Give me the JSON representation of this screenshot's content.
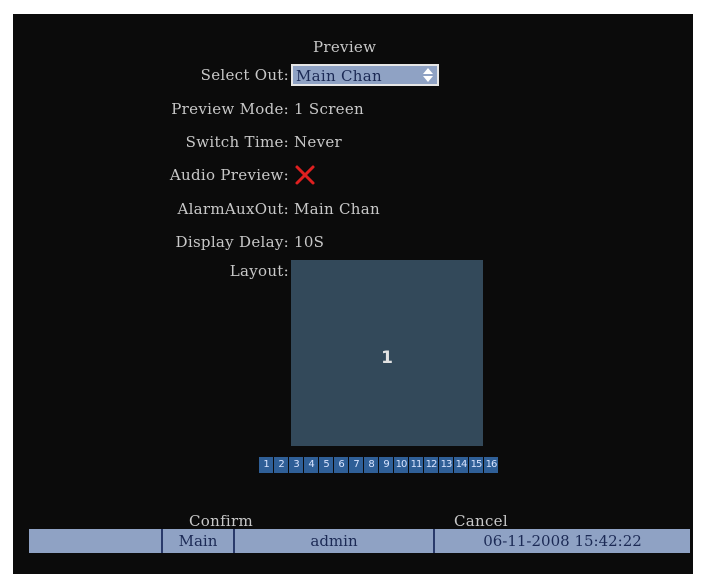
{
  "title": "Preview",
  "fields": {
    "select_out_label": "Select Out:",
    "select_out_value": "Main Chan",
    "preview_mode_label": "Preview Mode:",
    "preview_mode_value": "1 Screen",
    "switch_time_label": "Switch Time:",
    "switch_time_value": "Never",
    "audio_preview_label": "Audio Preview:",
    "audio_preview_enabled": false,
    "alarm_aux_out_label": "AlarmAuxOut:",
    "alarm_aux_out_value": "Main Chan",
    "display_delay_label": "Display Delay:",
    "display_delay_value": "10S",
    "layout_label": "Layout:"
  },
  "layout": {
    "window_number": "1",
    "channels": [
      "1",
      "2",
      "3",
      "4",
      "5",
      "6",
      "7",
      "8",
      "9",
      "10",
      "11",
      "12",
      "13",
      "14",
      "15",
      "16"
    ]
  },
  "buttons": {
    "confirm": "Confirm",
    "cancel": "Cancel"
  },
  "status_bar": {
    "segments": [
      "",
      "Main",
      "admin",
      "06-11-2008 15:42:22"
    ]
  },
  "colors": {
    "background": "#0b0b0b",
    "text": "#c8c8c8",
    "highlight": "#8fa2c4",
    "layout_fill": "#33495a",
    "channel_button": "#2f5f97",
    "disabled_x": "#e02020"
  },
  "icons": {
    "select_arrows": "up-down-arrows-icon",
    "audio_disabled": "red-x-icon"
  }
}
